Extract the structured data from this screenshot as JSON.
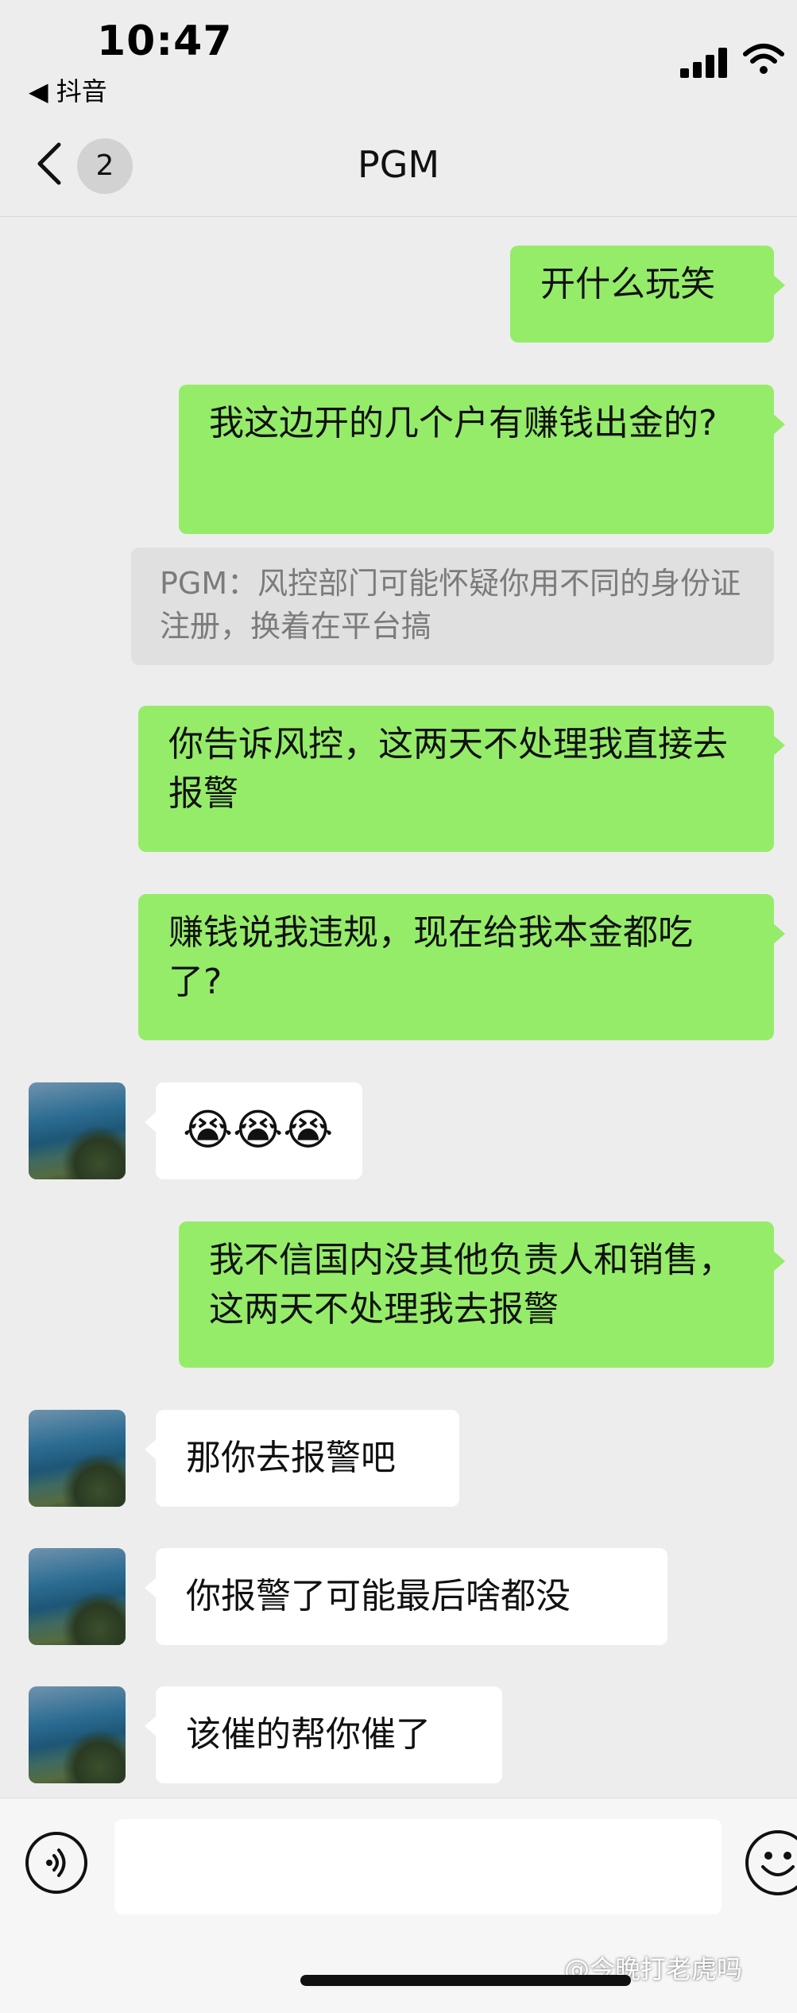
{
  "status": {
    "time": "10:47",
    "back_app": "◀ 抖音"
  },
  "nav": {
    "badge": "2",
    "title": "PGM"
  },
  "messages": [
    {
      "dir": "out",
      "text": "开什么玩笑"
    },
    {
      "dir": "out",
      "text": "我这边开的几个户有赚钱出金的?"
    },
    {
      "dir": "quote",
      "text": "PGM：风控部门可能怀疑你用不同的身份证注册，换着在平台搞"
    },
    {
      "dir": "out",
      "text": "你告诉风控，这两天不处理我直接去报警"
    },
    {
      "dir": "out",
      "text": "赚钱说我违规，现在给我本金都吃了?"
    },
    {
      "dir": "in",
      "text": "😭😭😭"
    },
    {
      "dir": "out",
      "text": "我不信国内没其他负责人和销售，这两天不处理我去报警"
    },
    {
      "dir": "in",
      "text": "那你去报警吧"
    },
    {
      "dir": "in",
      "text": "你报警了可能最后啥都没"
    },
    {
      "dir": "in",
      "text": "该催的帮你催了"
    }
  ],
  "input": {
    "value": ""
  },
  "watermark": "@今晚打老虎吗",
  "colors": {
    "outgoing_bubble": "#95ec69",
    "incoming_bubble": "#ffffff",
    "background": "#ededed"
  },
  "icons": [
    "back-arrow-icon",
    "signal-icon",
    "wifi-icon",
    "voice-icon",
    "emoji-icon"
  ]
}
